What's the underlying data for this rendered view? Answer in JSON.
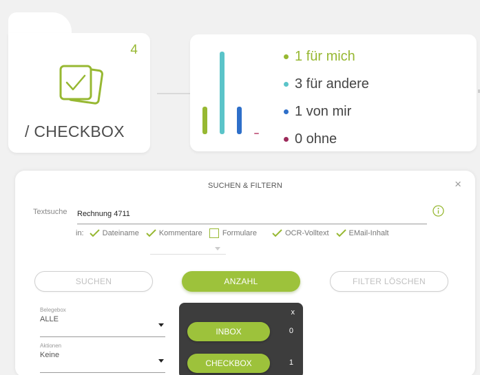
{
  "checkbox_card": {
    "count": "4",
    "title": "/ CHECKBOX"
  },
  "stats": {
    "items": [
      {
        "label": "1 für mich",
        "value": 1,
        "color": "#97b832"
      },
      {
        "label": "3 für andere",
        "value": 3,
        "color": "#5bc4c9"
      },
      {
        "label": "1 von mir",
        "value": 1,
        "color": "#2e6fc9"
      },
      {
        "label": "0 ohne",
        "value": 0,
        "color": "#9c2a5a"
      }
    ]
  },
  "search_panel": {
    "title": "SUCHEN & FILTERN",
    "close": "×",
    "text_search_label": "Textsuche",
    "text_search_value": "Rechnung 4711",
    "in_label": "in:",
    "options": [
      {
        "label": "Dateiname",
        "checked": true
      },
      {
        "label": "Kommentare",
        "checked": true
      },
      {
        "label": "Formulare",
        "checked": false
      },
      {
        "label": "OCR-Volltext",
        "checked": true
      },
      {
        "label": "EMail-Inhalt",
        "checked": true
      }
    ],
    "buttons": {
      "search": "SUCHEN",
      "count": "ANZAHL",
      "clear": "FILTER LÖSCHEN"
    },
    "fields": [
      {
        "label": "Belegebox",
        "value": "ALLE"
      },
      {
        "label": "Aktionen",
        "value": "Keine"
      }
    ],
    "count_popup": {
      "close": "x",
      "rows": [
        {
          "label": "INBOX",
          "count": "0"
        },
        {
          "label": "CHECKBOX",
          "count": "1"
        }
      ]
    }
  },
  "colors": {
    "accent": "#97b832",
    "button_green": "#9dc23b",
    "popup_bg": "#3d3d3d"
  }
}
